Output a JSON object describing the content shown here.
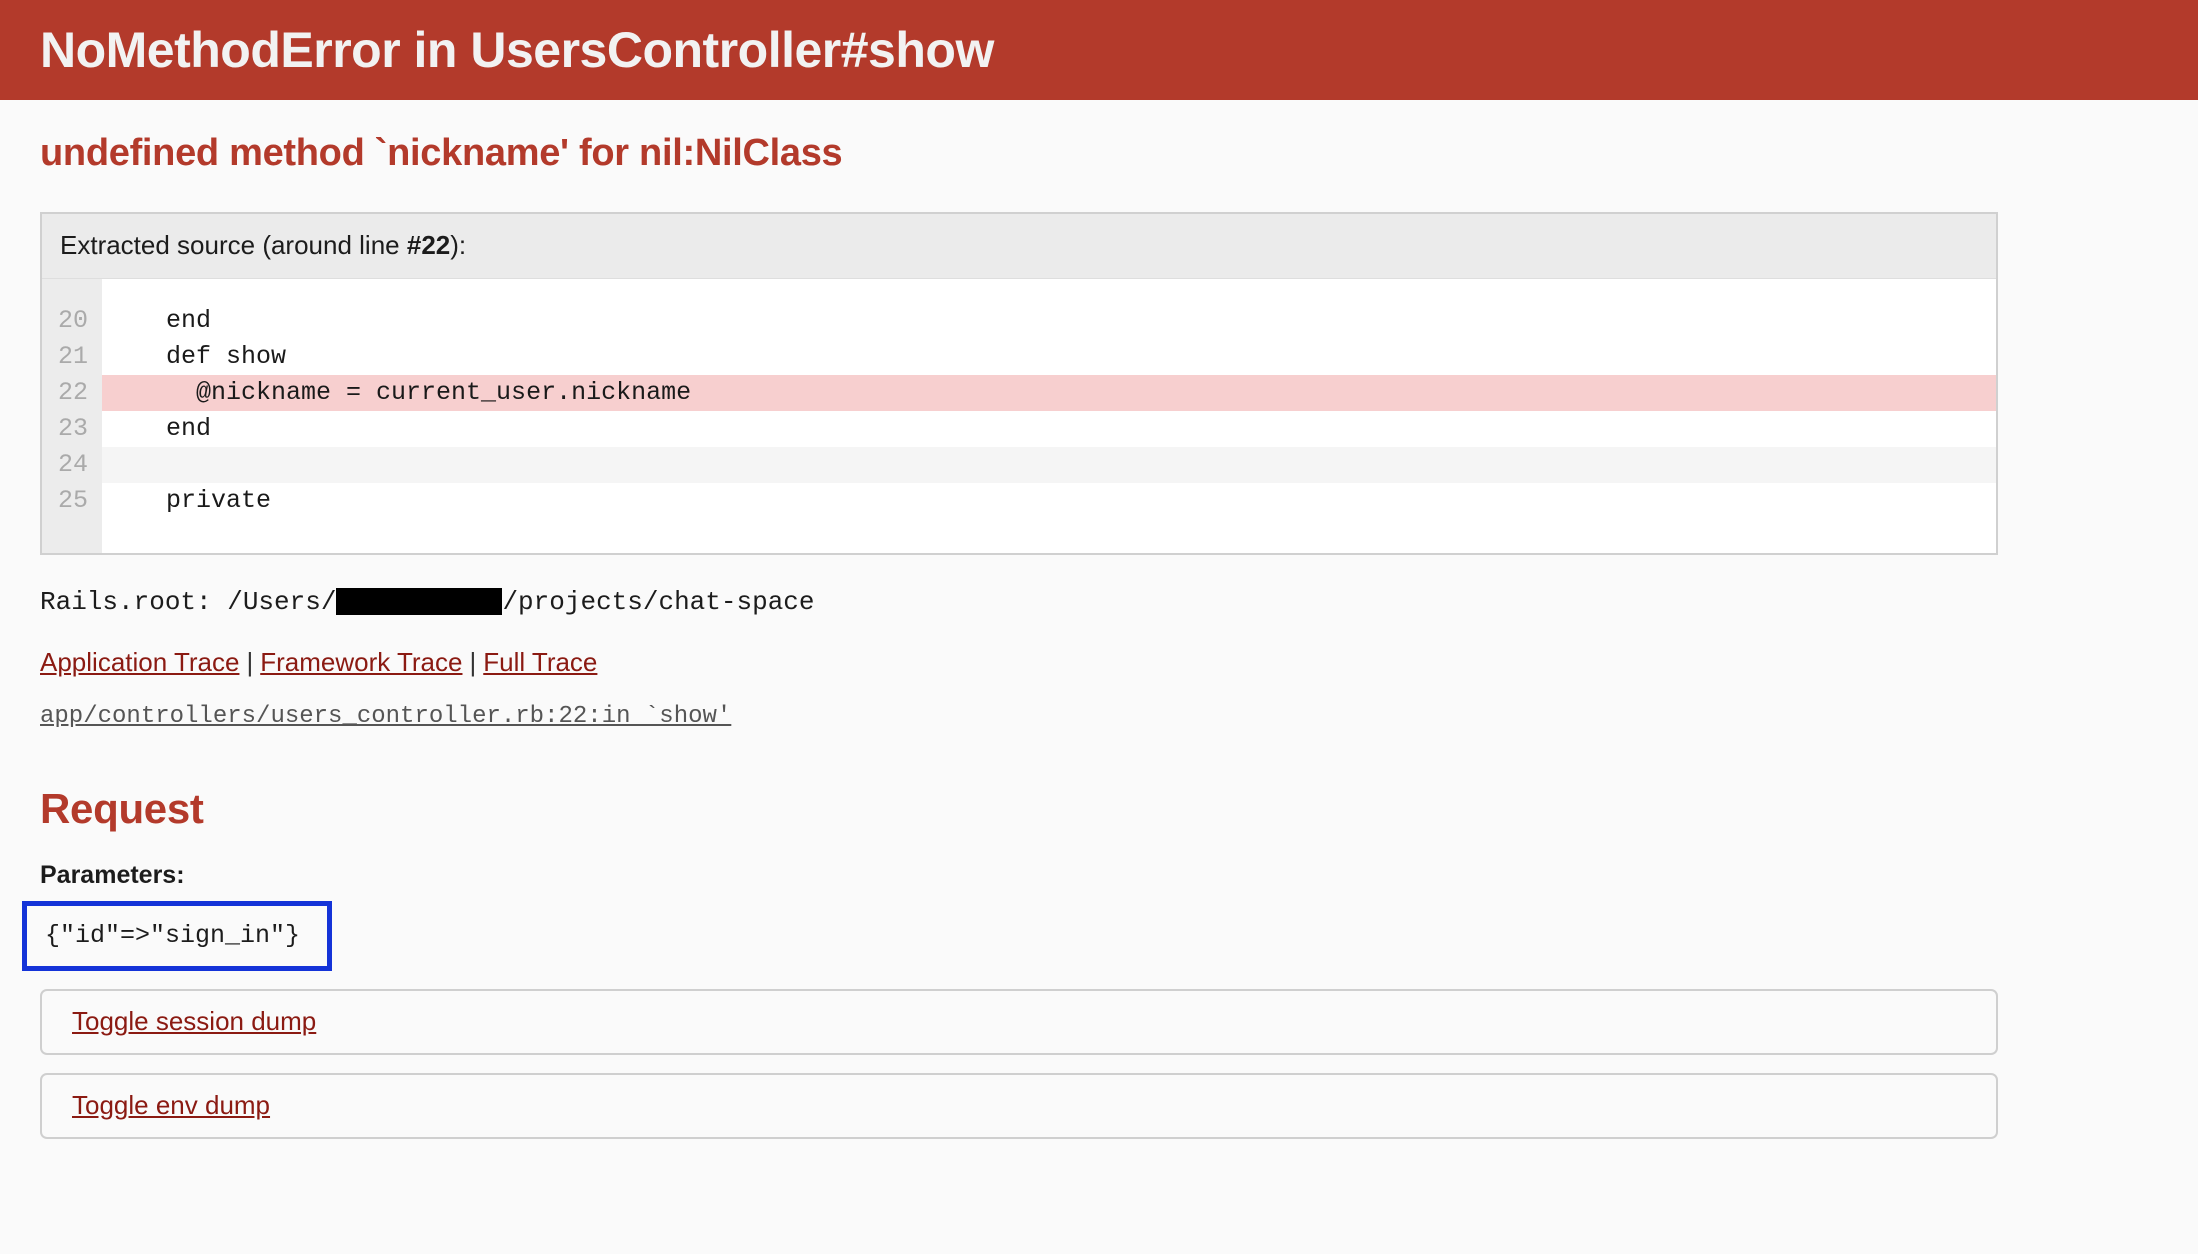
{
  "header": {
    "title": "NoMethodError in UsersController#show"
  },
  "error": {
    "message": "undefined method `nickname' for nil:NilClass"
  },
  "extracted_source": {
    "title_prefix": "Extracted source (around line ",
    "line_ref": "#22",
    "title_suffix": "):",
    "lines": [
      {
        "number": "20",
        "code": "  end",
        "state": "normal"
      },
      {
        "number": "21",
        "code": "  def show",
        "state": "normal"
      },
      {
        "number": "22",
        "code": "    @nickname = current_user.nickname",
        "state": "highlight"
      },
      {
        "number": "23",
        "code": "  end",
        "state": "normal"
      },
      {
        "number": "24",
        "code": "",
        "state": "alt"
      },
      {
        "number": "25",
        "code": "  private",
        "state": "normal"
      }
    ]
  },
  "rails_root": {
    "prefix": "Rails.root: /Users/",
    "redacted": "",
    "suffix": "/projects/chat-space"
  },
  "traces": {
    "application": "Application Trace",
    "framework": "Framework Trace",
    "full": "Full Trace",
    "separator": "|",
    "path": "app/controllers/users_controller.rb:22:in `show'"
  },
  "request": {
    "heading": "Request",
    "parameters_label": "Parameters:",
    "parameters_value": "{\"id\"=>\"sign_in\"}",
    "toggle_session": "Toggle session dump",
    "toggle_env": "Toggle env dump"
  },
  "colors": {
    "header_bg": "#b33a2b",
    "accent_red": "#b33a2b",
    "link_red": "#8b1a12",
    "highlight_pink": "#f7cfcf",
    "annotation_blue": "#1433d8",
    "page_bg": "#fafafa"
  }
}
